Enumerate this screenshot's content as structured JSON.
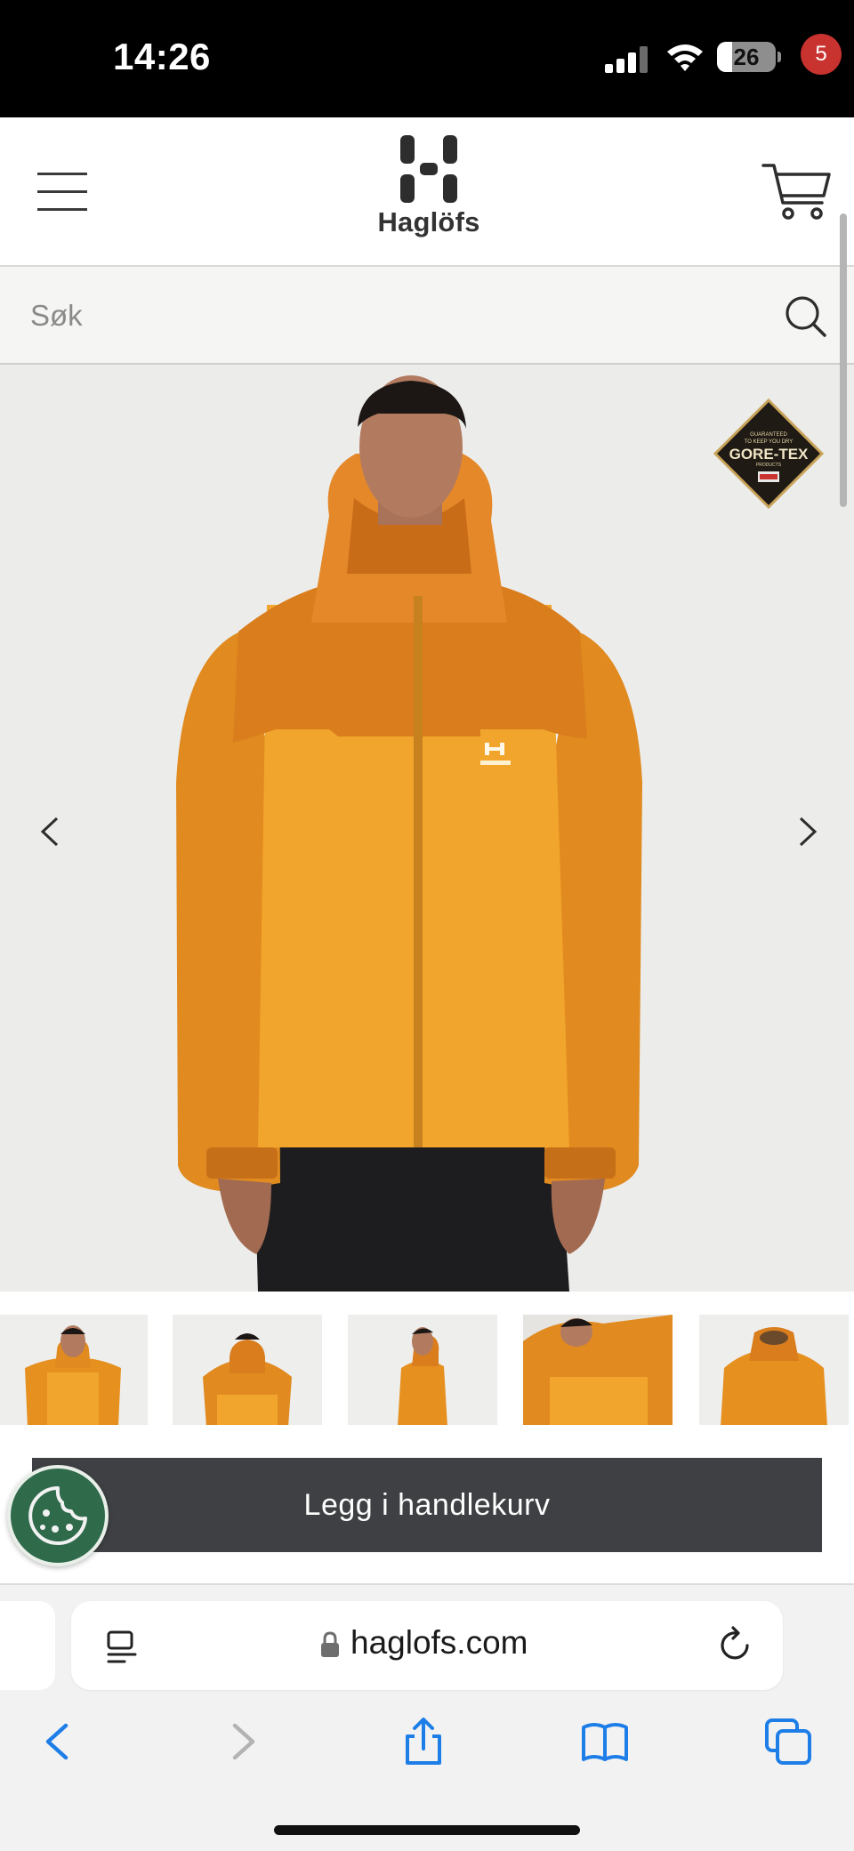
{
  "status_bar": {
    "time": "14:26",
    "battery": "26",
    "battery_level": 0.26
  },
  "header": {
    "brand": "Haglöfs",
    "cart_count": "5"
  },
  "search": {
    "placeholder": "Søk"
  },
  "product": {
    "badge": {
      "line1": "GUARANTEED",
      "line2": "TO KEEP YOU DRY",
      "line3": "GORE-TEX",
      "line4": "PRODUCTS"
    },
    "thumbnails": [
      "front",
      "back",
      "side",
      "detail",
      "flat"
    ],
    "add_to_cart": "Legg i handlekurv"
  },
  "browser": {
    "url": "haglofs.com"
  },
  "colors": {
    "jacket_dark": "#d97f1f",
    "jacket_light": "#f0a62a",
    "button": "#3e4043",
    "badge": "#c8322f",
    "cookie": "#2f6a4b",
    "ios_blue": "#1e7ee8"
  },
  "icons": {
    "menu": "hamburger-icon",
    "cart": "cart-icon",
    "search": "search-icon",
    "prev": "chevron-left-icon",
    "next": "chevron-right-icon",
    "cookie": "cookie-icon",
    "reader": "reader-icon",
    "lock": "lock-icon",
    "reload": "reload-icon",
    "back": "back-icon",
    "forward": "forward-icon",
    "share": "share-icon",
    "bookmarks": "bookmarks-icon",
    "tabs": "tabs-icon"
  }
}
